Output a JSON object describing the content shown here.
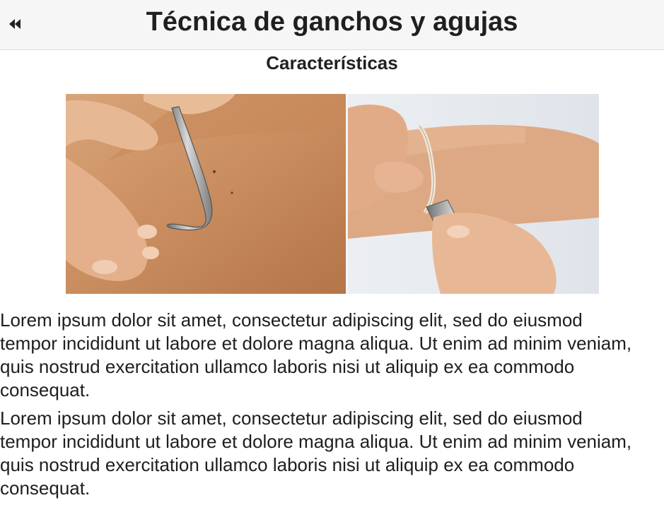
{
  "header": {
    "title": "Técnica de ganchos y agujas",
    "back_icon": "rewind-back-icon"
  },
  "section": {
    "subtitle": "Características"
  },
  "figure": {
    "left_image": "hand-hook-on-shoulder-photo",
    "right_image": "hand-hook-on-forearm-photo"
  },
  "paragraphs": [
    "Lorem ipsum dolor sit amet, consectetur adipiscing elit, sed do eiusmod tempor incididunt ut labore et dolore magna aliqua. Ut enim ad minim veniam, quis nostrud exercitation ullamco laboris nisi ut aliquip ex ea commodo consequat.",
    "Lorem ipsum dolor sit amet, consectetur adipiscing elit, sed do eiusmod tempor incididunt ut labore et dolore magna aliqua. Ut enim ad minim veniam, quis nostrud exercitation ullamco laboris nisi ut aliquip ex ea commodo consequat."
  ]
}
